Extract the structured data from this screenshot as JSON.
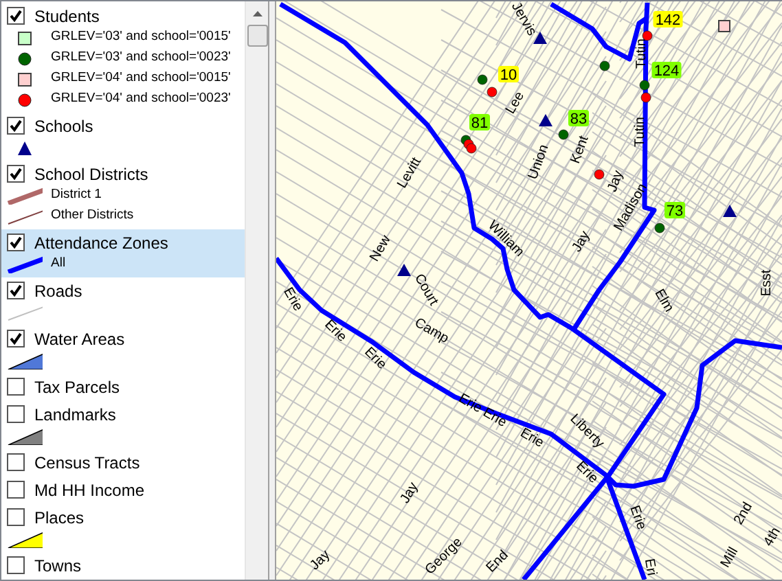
{
  "legend": {
    "layers": [
      {
        "name": "Students",
        "checked": true,
        "selected": false,
        "symbols": [
          {
            "kind": "square",
            "color": "#c8ffc8",
            "label": "GRLEV='03' and school='0015'"
          },
          {
            "kind": "circle",
            "color": "#006400",
            "label": "GRLEV='03' and school='0023'"
          },
          {
            "kind": "square",
            "color": "#ffd0d0",
            "label": "GRLEV='04' and school='0015'"
          },
          {
            "kind": "circle",
            "color": "#ff0000",
            "label": "GRLEV='04' and school='0023'"
          }
        ]
      },
      {
        "name": "Schools",
        "checked": true,
        "selected": false,
        "symbols": [
          {
            "kind": "triangle",
            "color": "#00008b"
          }
        ]
      },
      {
        "name": "School Districts",
        "checked": true,
        "selected": false,
        "symbols": [
          {
            "kind": "thick-line",
            "color": "#b06868",
            "label": "District 1"
          },
          {
            "kind": "thin-line",
            "color": "#804040",
            "label": "Other Districts"
          }
        ]
      },
      {
        "name": "Attendance Zones",
        "checked": true,
        "selected": true,
        "symbols": [
          {
            "kind": "thick-line",
            "color": "#0000ff",
            "label": "All"
          }
        ]
      },
      {
        "name": "Roads",
        "checked": true,
        "selected": false,
        "symbols": [
          {
            "kind": "thin-line",
            "color": "#c0c0c0"
          }
        ]
      },
      {
        "name": "Water Areas",
        "checked": true,
        "selected": false,
        "symbols": [
          {
            "kind": "wedge",
            "color": "#5078d8"
          }
        ]
      },
      {
        "name": "Tax Parcels",
        "checked": false,
        "selected": false
      },
      {
        "name": "Landmarks",
        "checked": false,
        "selected": false,
        "symbols": [
          {
            "kind": "wedge",
            "color": "#808080"
          }
        ]
      },
      {
        "name": "Census Tracts",
        "checked": false,
        "selected": false
      },
      {
        "name": "Md HH Income",
        "checked": false,
        "selected": false
      },
      {
        "name": "Places",
        "checked": false,
        "selected": false,
        "symbols": [
          {
            "kind": "wedge",
            "color": "#ffff00"
          }
        ]
      },
      {
        "name": "Towns",
        "checked": false,
        "selected": false
      }
    ]
  },
  "map": {
    "streets": [
      "Jervis",
      "Lee",
      "Union",
      "Kent",
      "Jay",
      "Tutin",
      "Tutin",
      "Madison",
      "Levitt",
      "William",
      "Jay",
      "New",
      "Court",
      "Elm",
      "Esst",
      "Erie",
      "Erie",
      "Erie",
      "Camp",
      "Erie Erie",
      "Erie",
      "Liberty",
      "Erie",
      "Erie",
      "Eri",
      "Jay",
      "Jay",
      "George",
      "End",
      "2nd",
      "4th",
      "Mill"
    ],
    "students": [
      {
        "kind": "circle",
        "color": "#006400"
      },
      {
        "kind": "circle",
        "color": "#ff0000"
      },
      {
        "kind": "circle",
        "color": "#006400"
      },
      {
        "kind": "circle",
        "color": "#ff0000"
      },
      {
        "kind": "circle",
        "color": "#ff0000"
      },
      {
        "kind": "circle",
        "color": "#006400"
      },
      {
        "kind": "circle",
        "color": "#ff0000"
      },
      {
        "kind": "circle",
        "color": "#006400"
      },
      {
        "kind": "circle",
        "color": "#ff0000"
      },
      {
        "kind": "circle",
        "color": "#006400"
      },
      {
        "kind": "circle",
        "color": "#ff0000"
      },
      {
        "kind": "circle",
        "color": "#006400"
      },
      {
        "kind": "square",
        "color": "#ffd0d0"
      }
    ],
    "counts": [
      {
        "text": "10",
        "color": "#ffff00"
      },
      {
        "text": "142",
        "color": "#ffff00"
      },
      {
        "text": "124",
        "color": "#80ff00"
      },
      {
        "text": "81",
        "color": "#80ff00"
      },
      {
        "text": "83",
        "color": "#80ff00"
      },
      {
        "text": "73",
        "color": "#80ff00"
      }
    ]
  }
}
